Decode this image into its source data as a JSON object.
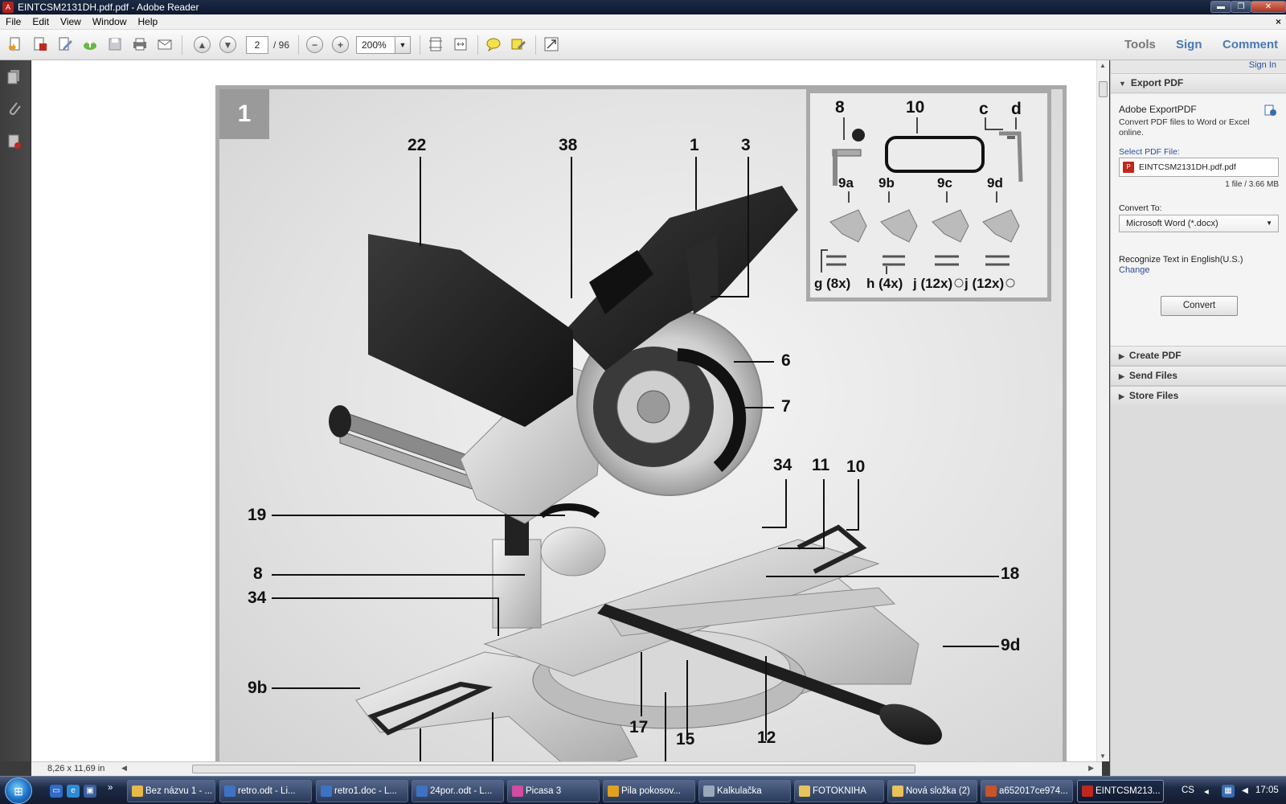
{
  "window": {
    "title": "EINTCSM2131DH.pdf.pdf - Adobe Reader",
    "min": "▬",
    "max": "❐",
    "close": "✕"
  },
  "menu": {
    "items": [
      "File",
      "Edit",
      "View",
      "Window",
      "Help"
    ],
    "close": "×"
  },
  "toolbar": {
    "page_current": "2",
    "page_total": "/ 96",
    "zoom": "200%",
    "tools_label": "Tools",
    "sign_label": "Sign",
    "comment_label": "Comment"
  },
  "figure": {
    "number": "1",
    "callouts": {
      "c22": "22",
      "c38": "38",
      "c1": "1",
      "c3": "3",
      "c6": "6",
      "c7": "7",
      "c34a": "34",
      "c11": "11",
      "c10": "10",
      "c19": "19",
      "c8": "8",
      "c18": "18",
      "c34b": "34",
      "c9d": "9d",
      "c9b": "9b",
      "c17": "17",
      "c15": "15",
      "c12": "12"
    },
    "inset": {
      "i8": "8",
      "i10": "10",
      "ic": "c",
      "id": "d",
      "i9a": "9a",
      "i9b": "9b",
      "i9c": "9c",
      "i9d": "9d",
      "ig": "g (8x)",
      "ih": "h (4x)",
      "ij1": "j (12x)",
      "ij2": "j (12x)"
    }
  },
  "status": {
    "page_size": "8,26 x 11,69 in"
  },
  "right_panel": {
    "sign_in": "Sign In",
    "export_pdf": "Export PDF",
    "service_title": "Adobe ExportPDF",
    "service_desc": "Convert PDF files to Word or Excel online.",
    "select_label": "Select PDF File:",
    "file_name": "EINTCSM2131DH.pdf.pdf",
    "file_meta": "1 file / 3.66 MB",
    "convert_to_label": "Convert To:",
    "convert_to_value": "Microsoft Word (*.docx)",
    "ocr_text": "Recognize Text in English(U.S.)",
    "change_link": "Change",
    "convert_button": "Convert",
    "create_pdf": "Create PDF",
    "send_files": "Send Files",
    "store_files": "Store Files"
  },
  "taskbar": {
    "chevron": "»",
    "buttons": [
      {
        "label": "Bez názvu 1 - ...",
        "icon_color": "#e8b84a"
      },
      {
        "label": "retro.odt - Li...",
        "icon_color": "#3e73c4"
      },
      {
        "label": "retro1.doc - L...",
        "icon_color": "#3e73c4"
      },
      {
        "label": "24por..odt - L...",
        "icon_color": "#3e73c4"
      },
      {
        "label": "Picasa 3",
        "icon_color": "#d04ca0"
      },
      {
        "label": "Pila pokosov...",
        "icon_color": "#e0a020"
      },
      {
        "label": "Kalkulačka",
        "icon_color": "#9aa8bc"
      },
      {
        "label": "FOTOKNIHA",
        "icon_color": "#e8c25a"
      },
      {
        "label": "Nová složka (2)",
        "icon_color": "#e8c25a"
      },
      {
        "label": "a652017ce974...",
        "icon_color": "#c9532a"
      },
      {
        "label": "EINTCSM213...",
        "icon_color": "#c0281f"
      }
    ],
    "lang": "CS",
    "clock": "17:05"
  }
}
